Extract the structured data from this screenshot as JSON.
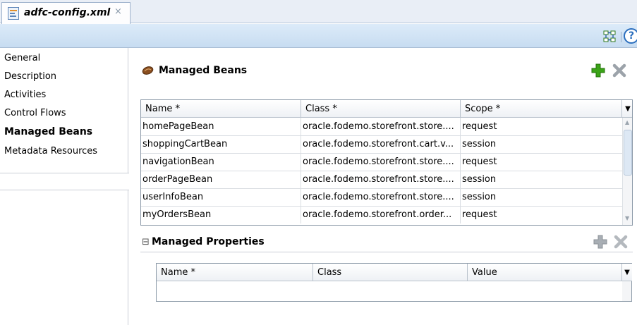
{
  "document_tab": {
    "title": "adfc-config.xml",
    "close_glyph": "×"
  },
  "toolbar": {
    "help_glyph": "?"
  },
  "nav": {
    "items": [
      {
        "label": "General"
      },
      {
        "label": "Description"
      },
      {
        "label": "Activities"
      },
      {
        "label": "Control Flows"
      },
      {
        "label": "Managed Beans",
        "selected": true
      },
      {
        "label": "Metadata Resources"
      }
    ]
  },
  "managed_beans": {
    "title": "Managed Beans",
    "columns": [
      "Name *",
      "Class *",
      "Scope *"
    ],
    "rows": [
      {
        "name": "homePageBean",
        "class": "oracle.fodemo.storefront.store....",
        "scope": "request"
      },
      {
        "name": "shoppingCartBean",
        "class": "oracle.fodemo.storefront.cart.v...",
        "scope": "session"
      },
      {
        "name": "navigationBean",
        "class": "oracle.fodemo.storefront.store....",
        "scope": "request"
      },
      {
        "name": "orderPageBean",
        "class": "oracle.fodemo.storefront.store....",
        "scope": "session"
      },
      {
        "name": "userInfoBean",
        "class": "oracle.fodemo.storefront.store....",
        "scope": "session"
      },
      {
        "name": "myOrdersBean",
        "class": "oracle.fodemo.storefront.order...",
        "scope": "request"
      }
    ]
  },
  "managed_properties": {
    "collapse_glyph": "⊟",
    "title": "Managed Properties",
    "columns": [
      "Name *",
      "Class",
      "Value"
    ]
  },
  "colors": {
    "add_enabled": "#3aa317",
    "remove_disabled": "#9ca3aa",
    "toolbar_bg": "#c7dcf1",
    "help_blue": "#2c6fbe"
  }
}
